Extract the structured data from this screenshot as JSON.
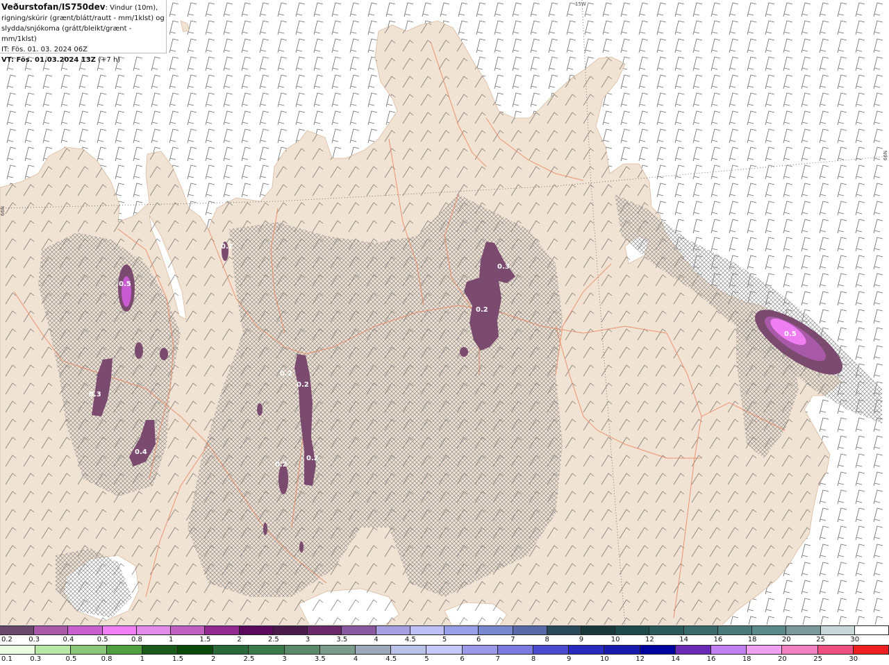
{
  "header": {
    "brand": "Veðurstofan/IS750dev",
    "line1_rest": ": Vindur (10m),",
    "line2": "rigning/skúrir (grænt/blátt/rautt - mm/1klst) og",
    "line3": "slydda/snjókoma (grátt/bleikt/grænt - mm/1klst)",
    "line4": "IT: Fös. 01. 03. 2024 06Z",
    "line5_bold": "VT: Fös. 01.03.2024 13Z",
    "line5_rest": " (+7 h)"
  },
  "grid_labels": {
    "lon": "15W",
    "lat_left": "66N",
    "lat_right": "66N"
  },
  "precip_labels": [
    "0.5",
    "0.3",
    "0.4",
    "0.2",
    "0.2",
    "0.3",
    "0.2",
    "0.5",
    "0.2",
    "0.2",
    "0.2"
  ],
  "colors": {
    "land": "#f1e3d3",
    "sea": "#ffffff",
    "roads": "#e9855f",
    "hatch": "#8c8c8c",
    "precip_main": "#7b4a6f",
    "precip_core": "#c85ad2",
    "precip_peak": "#ef7ef2"
  },
  "colorbar_snow": {
    "ticks": [
      "0.2",
      "0.3",
      "0.4",
      "0.5",
      "0.8",
      "1",
      "1.5",
      "2",
      "2.5",
      "3",
      "3.5",
      "4",
      "4.5",
      "5",
      "6",
      "7",
      "8",
      "9",
      "10",
      "12",
      "14",
      "16",
      "18",
      "20",
      "25",
      "30"
    ],
    "colors": [
      "#6a4a6a",
      "#a85aa8",
      "#c860d0",
      "#f07ef5",
      "#e08ce8",
      "#c060c0",
      "#902a90",
      "#5a0a5a",
      "#4a1a4a",
      "#6a2a6a",
      "#8a5aa0",
      "#a8a0e0",
      "#c0c0f8",
      "#9aa0e8",
      "#7a88d0",
      "#5a6aa8",
      "#2a4a5a",
      "#1a3a3a",
      "#1e4a4a",
      "#2a5a5a",
      "#3a6a6a",
      "#4a7a7a",
      "#5a8a8a",
      "#7a9a9a",
      "#c8d8d8",
      "#ffffff"
    ]
  },
  "colorbar_rain": {
    "ticks": [
      "0.1",
      "0.3",
      "0.5",
      "0.8",
      "1",
      "1.5",
      "2",
      "2.5",
      "3",
      "3.5",
      "4",
      "4.5",
      "5",
      "6",
      "7",
      "8",
      "9",
      "10",
      "12",
      "14",
      "16",
      "18",
      "20",
      "25",
      "30"
    ],
    "colors": [
      "#e8ffe0",
      "#b8e8a8",
      "#88c878",
      "#50a040",
      "#1a5a1a",
      "#0a4a0a",
      "#2a6a3a",
      "#3a7a4a",
      "#5a8a6a",
      "#7a9a8a",
      "#9aaabb",
      "#b8c0e8",
      "#c8c8f8",
      "#9a9ae8",
      "#7a7ae0",
      "#4a4ad0",
      "#2a2ac0",
      "#1a1ab0",
      "#0000a0",
      "#6a2ab8",
      "#c080f0",
      "#f0a0f0",
      "#f080c0",
      "#f05080",
      "#f02020"
    ]
  }
}
